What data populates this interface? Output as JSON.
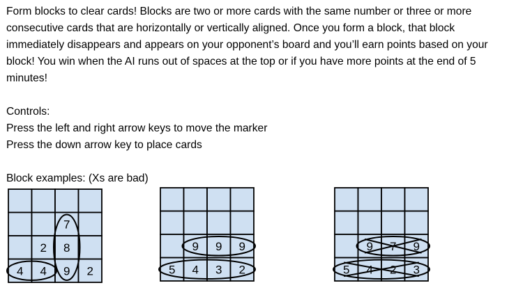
{
  "instructions": {
    "intro": "Form blocks to clear cards!  Blocks are two or more cards with the same number or three or more consecutive cards that are horizontally or vertically aligned. Once you form a block, that block immediately disappears and appears on your opponent’s board and you’ll earn points based on your block!   You win when the AI runs out of spaces at the top or if you have more points at the end of 5 minutes!",
    "controls_heading": "Controls:",
    "controls": [
      "Press the left and right arrow keys to move the marker",
      "Press the down arrow key to place cards"
    ],
    "examples_heading": "Block examples: (Xs are bad)"
  },
  "colors": {
    "cell_fill": "#cfe0f2",
    "grid_line": "#000000",
    "mark_line": "#000000"
  },
  "examples": [
    {
      "grid": [
        [
          "",
          "",
          "",
          ""
        ],
        [
          "",
          "",
          "7",
          ""
        ],
        [
          "",
          "2",
          "8",
          ""
        ],
        [
          "4",
          "4",
          "9",
          "2"
        ]
      ],
      "marks": [
        {
          "kind": "ellipse",
          "cells": [
            [
              3,
              0
            ],
            [
              3,
              1
            ]
          ]
        },
        {
          "kind": "ellipse",
          "cells": [
            [
              1,
              2
            ],
            [
              2,
              2
            ],
            [
              3,
              2
            ]
          ]
        }
      ]
    },
    {
      "grid": [
        [
          "",
          "",
          "",
          ""
        ],
        [
          "",
          "",
          "",
          ""
        ],
        [
          "",
          "",
          "",
          ""
        ],
        [
          "",
          "",
          "",
          ""
        ]
      ],
      "cards": [
        {
          "row": 2,
          "col": 1,
          "value": "9"
        },
        {
          "row": 2,
          "col": 2,
          "value": "9"
        },
        {
          "row": 2,
          "col": 3,
          "value": "9"
        },
        {
          "row": 3,
          "col": 0,
          "value": "5"
        },
        {
          "row": 3,
          "col": 1,
          "value": "4"
        },
        {
          "row": 3,
          "col": 2,
          "value": "3"
        },
        {
          "row": 3,
          "col": 3,
          "value": "2"
        }
      ],
      "marks": [
        {
          "kind": "ellipse",
          "cells": [
            [
              2,
              1
            ],
            [
              2,
              2
            ],
            [
              2,
              3
            ]
          ]
        },
        {
          "kind": "ellipse",
          "cells": [
            [
              3,
              0
            ],
            [
              3,
              1
            ],
            [
              3,
              2
            ],
            [
              3,
              3
            ]
          ]
        }
      ]
    },
    {
      "grid": [
        [
          "",
          "",
          "",
          ""
        ],
        [
          "",
          "",
          "",
          ""
        ],
        [
          "",
          "9",
          "7",
          "9"
        ],
        [
          "5",
          "4",
          "2",
          "3"
        ]
      ],
      "marks": [
        {
          "kind": "ellipse-x",
          "cells": [
            [
              2,
              1
            ],
            [
              2,
              2
            ],
            [
              2,
              3
            ]
          ]
        },
        {
          "kind": "ellipse-x",
          "cells": [
            [
              3,
              0
            ],
            [
              3,
              1
            ],
            [
              3,
              2
            ],
            [
              3,
              3
            ]
          ]
        }
      ]
    }
  ]
}
